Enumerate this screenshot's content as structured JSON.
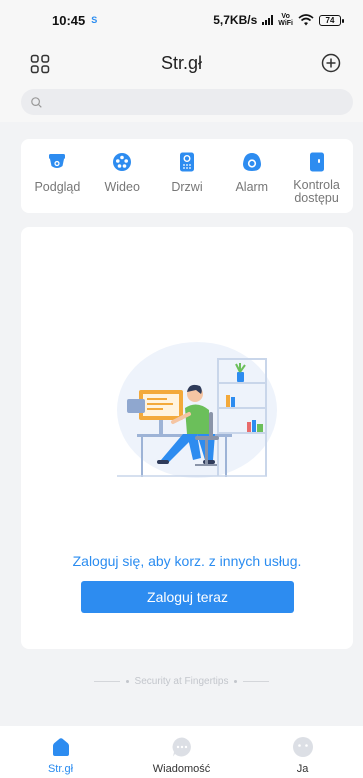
{
  "status_bar": {
    "time": "10:45",
    "s_badge": "S",
    "speed": "5,7KB/s",
    "volte_top": "Vo",
    "volte_bottom": "WiFi",
    "battery": "74"
  },
  "header": {
    "title": "Str.gł",
    "grid_icon": "grid-icon",
    "add_icon": "add-circle-icon"
  },
  "search": {
    "placeholder": "",
    "icon": "search-icon"
  },
  "quick_actions": [
    {
      "label": "Podgląd",
      "icon": "camera-icon"
    },
    {
      "label": "Wideo",
      "icon": "video-reel-icon"
    },
    {
      "label": "Drzwi",
      "icon": "door-intercom-icon"
    },
    {
      "label": "Alarm",
      "icon": "alarm-icon"
    },
    {
      "label": "Kontrola dostępu",
      "icon": "access-control-icon"
    }
  ],
  "main": {
    "login_prompt": "Zaloguj się, aby korz. z innych usług.",
    "login_button": "Zaloguj teraz"
  },
  "footer": {
    "tagline": "Security at Fingertips"
  },
  "bottom_nav": [
    {
      "label": "Str.gł",
      "icon": "home-icon",
      "active": true
    },
    {
      "label": "Wiadomość",
      "icon": "message-icon",
      "active": false
    },
    {
      "label": "Ja",
      "icon": "profile-icon",
      "active": false
    }
  ],
  "colors": {
    "accent": "#2d8cf0",
    "inactive_icon": "#dcdfe5",
    "background": "#f2f3f5"
  }
}
